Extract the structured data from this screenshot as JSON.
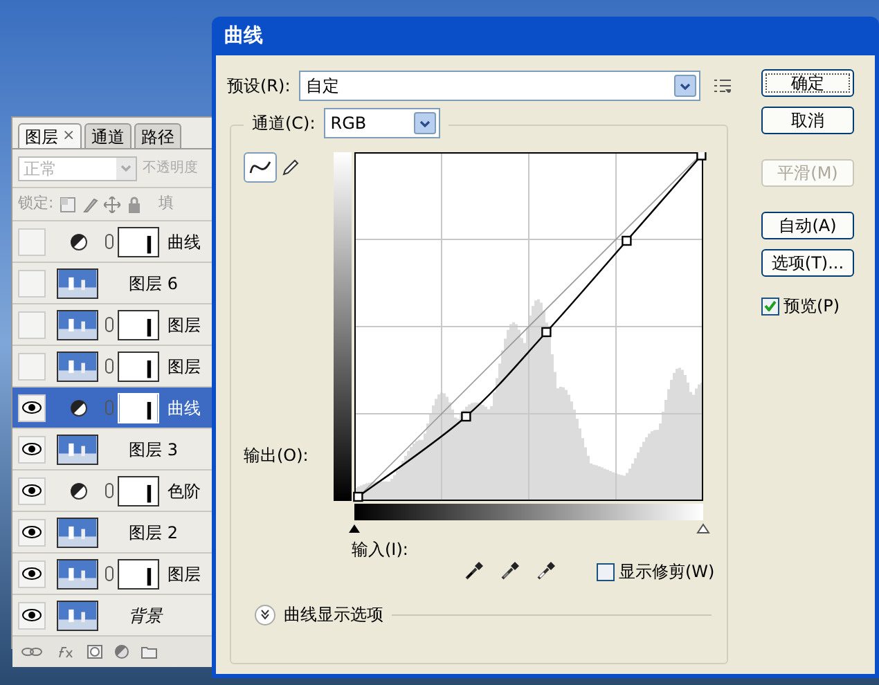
{
  "layers_panel": {
    "tabs": [
      {
        "label": "图层",
        "selected": true,
        "close": "×"
      },
      {
        "label": "通道",
        "selected": false
      },
      {
        "label": "路径",
        "selected": false
      }
    ],
    "blend_mode": {
      "value": "正常",
      "disabled": true
    },
    "opacity_label": "不透明度",
    "lock_label": "锁定:",
    "fill_label": "填",
    "layers": [
      {
        "kind": "adjustment",
        "name": "曲线",
        "visible": false,
        "mask": true,
        "selected": false
      },
      {
        "kind": "pixel",
        "name": "图层 6",
        "visible": false,
        "mask": false,
        "selected": false
      },
      {
        "kind": "pixel",
        "name": "图层",
        "visible": false,
        "mask": true,
        "selected": false
      },
      {
        "kind": "pixel",
        "name": "图层",
        "visible": false,
        "mask": true,
        "selected": false
      },
      {
        "kind": "adjustment",
        "name": "曲线",
        "visible": true,
        "mask": true,
        "selected": true
      },
      {
        "kind": "pixel",
        "name": "图层 3",
        "visible": true,
        "mask": false,
        "selected": false
      },
      {
        "kind": "adjustment",
        "name": "色阶",
        "visible": true,
        "mask": true,
        "selected": false
      },
      {
        "kind": "pixel",
        "name": "图层 2",
        "visible": true,
        "mask": false,
        "selected": false
      },
      {
        "kind": "pixel",
        "name": "图层",
        "visible": true,
        "mask": true,
        "selected": false
      },
      {
        "kind": "background",
        "name": "背景",
        "visible": true,
        "mask": false,
        "selected": false
      }
    ]
  },
  "dialog": {
    "title": "曲线",
    "preset_label": "预设(R):",
    "preset_value": "自定",
    "channel_label": "通道(C):",
    "channel_value": "RGB",
    "output_label": "输出(O):",
    "input_sliders": [
      {
        "kind": "shadow",
        "level": 0
      },
      {
        "kind": "highlight",
        "level": 1
      }
    ],
    "input_label": "输入(I):",
    "show_clipping": {
      "label": "显示修剪(W)",
      "checked": false
    },
    "display_options": {
      "label": "曲线显示选项",
      "expanded": false
    },
    "buttons": [
      {
        "label": "确定",
        "default": true,
        "disabled": false
      },
      {
        "label": "取消",
        "default": false,
        "disabled": false
      },
      {
        "label": "平滑(M)",
        "default": false,
        "disabled": true
      },
      {
        "label": "自动(A)",
        "default": false,
        "disabled": false
      },
      {
        "label": "选项(T)...",
        "default": false,
        "disabled": false
      }
    ],
    "preview": {
      "label": "预览(P)",
      "checked": true
    }
  }
}
